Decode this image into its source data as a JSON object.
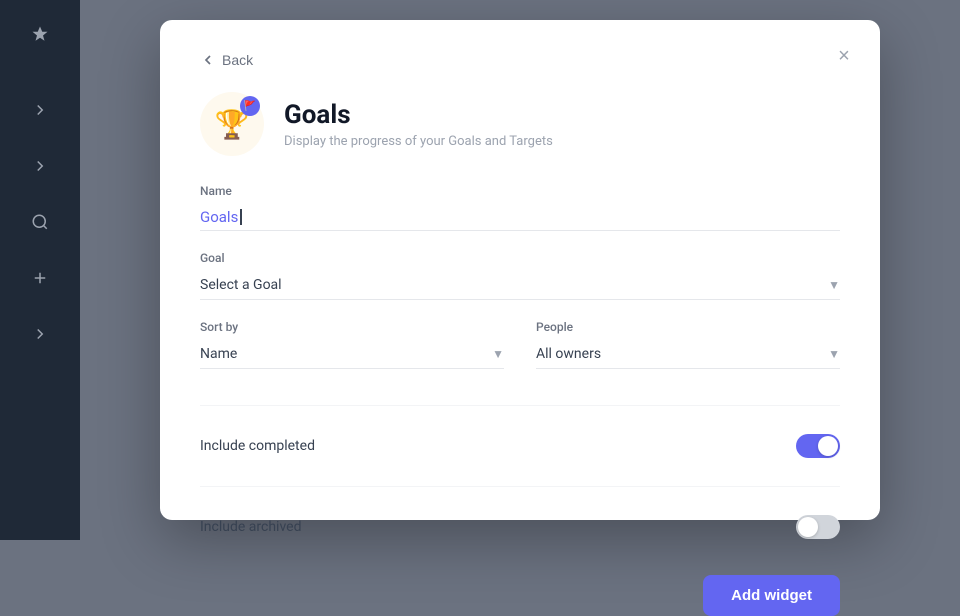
{
  "sidebar": {
    "items": [
      {
        "icon": "diamond",
        "label": "Logo"
      },
      {
        "icon": "chevron-right",
        "label": "Collapse"
      },
      {
        "icon": "chevron-right",
        "label": "Collapse 2"
      },
      {
        "icon": "search",
        "label": "Search"
      },
      {
        "icon": "plus",
        "label": "Add"
      },
      {
        "icon": "chevron-right",
        "label": "Collapse 3"
      }
    ]
  },
  "modal": {
    "back_label": "Back",
    "close_label": "×",
    "title": "Goals",
    "subtitle": "Display the progress of your Goals and Targets",
    "form": {
      "name_label": "Name",
      "name_value": "Goals",
      "goal_label": "Goal",
      "goal_placeholder": "Select a Goal",
      "sort_label": "Sort by",
      "sort_value": "Name",
      "people_label": "People",
      "people_value": "All owners",
      "include_completed_label": "Include completed",
      "include_completed_on": true,
      "include_archived_label": "Include archived",
      "include_archived_on": false
    },
    "add_widget_label": "Add widget"
  }
}
